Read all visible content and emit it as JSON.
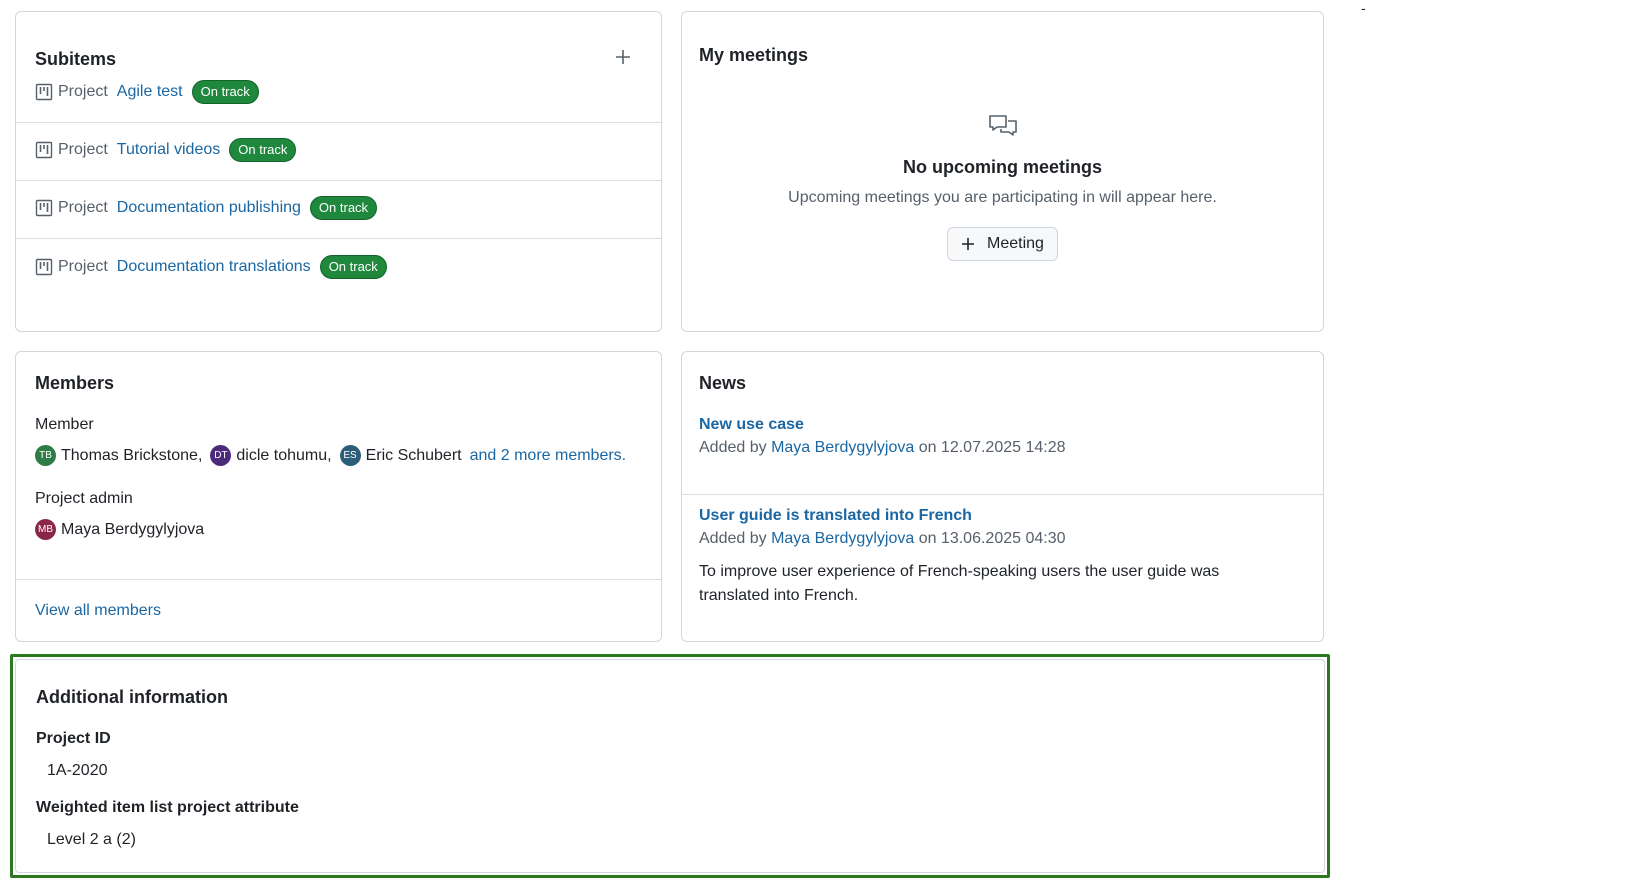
{
  "subitems": {
    "title": "Subitems",
    "items": [
      {
        "type": "Project",
        "name": "Agile test",
        "status": "On track"
      },
      {
        "type": "Project",
        "name": "Tutorial videos",
        "status": "On track"
      },
      {
        "type": "Project",
        "name": "Documentation publishing",
        "status": "On track"
      },
      {
        "type": "Project",
        "name": "Documentation translations",
        "status": "On track"
      }
    ]
  },
  "meetings": {
    "title": "My meetings",
    "empty_title": "No upcoming meetings",
    "empty_text": "Upcoming meetings you are participating in will appear here.",
    "button_label": "Meeting"
  },
  "members": {
    "title": "Members",
    "groups": [
      {
        "role": "Member",
        "people": [
          {
            "initials": "TB",
            "name": "Thomas Brickstone,",
            "color": "#2e7d46"
          },
          {
            "initials": "DT",
            "name": "dicle tohumu,",
            "color": "#4a2b7a"
          },
          {
            "initials": "ES",
            "name": "Eric Schubert",
            "color": "#2b5d78"
          }
        ],
        "more": "and 2 more members."
      },
      {
        "role": "Project admin",
        "people": [
          {
            "initials": "MB",
            "name": "Maya Berdygylyjova",
            "color": "#8a2747"
          }
        ]
      }
    ],
    "view_all": "View all members"
  },
  "news": {
    "title": "News",
    "items": [
      {
        "title": "New use case",
        "added_by": "Added by",
        "author": "Maya Berdygylyjova",
        "date": "on 12.07.2025 14:28",
        "body": ""
      },
      {
        "title": "User guide is translated into French",
        "added_by": "Added by",
        "author": "Maya Berdygylyjova",
        "date": "on 13.06.2025 04:30",
        "body": "To improve user experience of French-speaking users the user guide was translated into French."
      }
    ]
  },
  "additional_info": {
    "title": "Additional information",
    "attributes": [
      {
        "label": "Project ID",
        "value": "1A-2020"
      },
      {
        "label": "Weighted item list project attribute",
        "value": "Level 2 a (2)"
      }
    ]
  },
  "misc": {
    "dash": "-"
  },
  "colors": {
    "link": "#1a67a3",
    "badge_green": "#1f883d",
    "highlight_border": "#2c7a1f"
  },
  "icons": {
    "subitem_type": "project-board-icon",
    "add": "plus-icon",
    "meetings_empty": "comment-discussion-icon"
  }
}
